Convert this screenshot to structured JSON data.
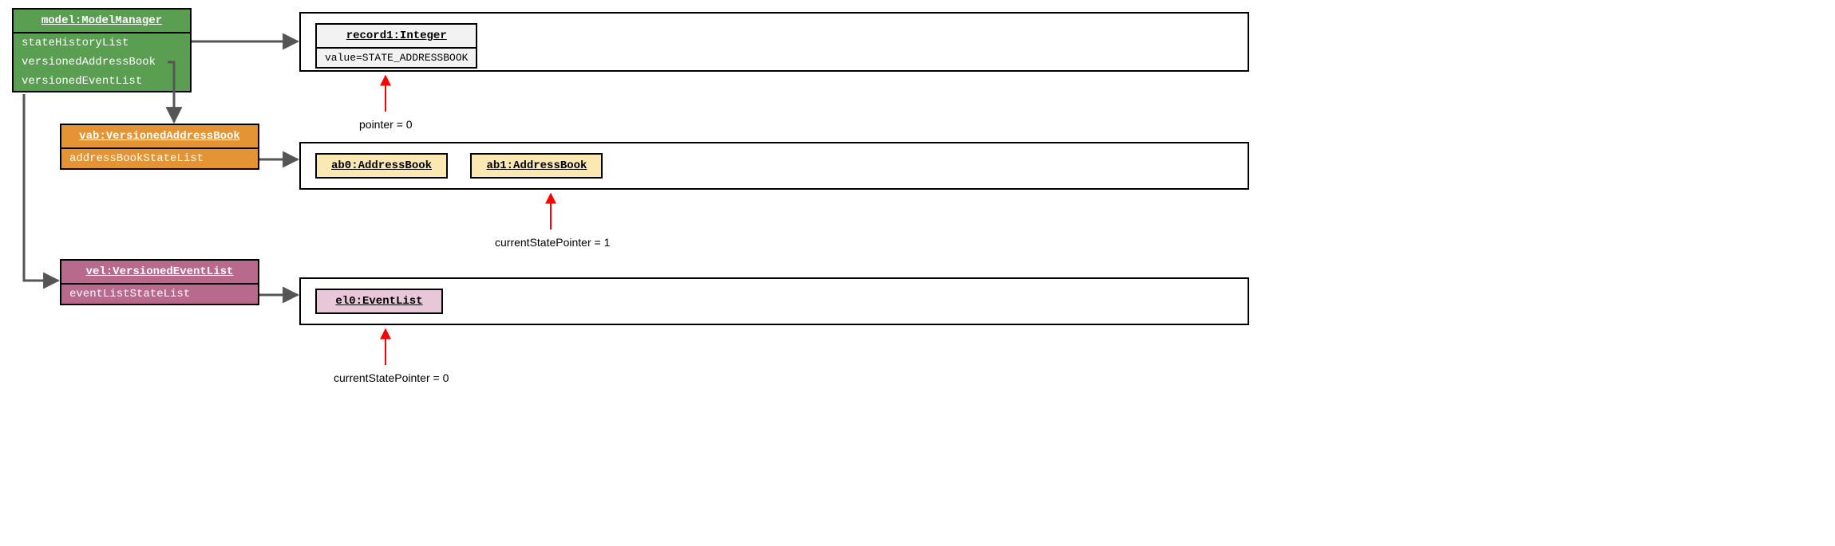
{
  "model": {
    "title": "model:ModelManager",
    "attrs": [
      "stateHistoryList",
      "versionedAddressBook",
      "versionedEventList"
    ]
  },
  "vab": {
    "title": "vab:VersionedAddressBook",
    "attrs": [
      "addressBookStateList"
    ]
  },
  "vel": {
    "title": "vel:VersionedEventList",
    "attrs": [
      "eventListStateList"
    ]
  },
  "stateHistory": {
    "record": {
      "title": "record1:Integer",
      "attr": "value=STATE_ADDRESSBOOK"
    },
    "pointerLabel": "pointer = 0"
  },
  "abList": {
    "items": [
      {
        "title": "ab0:AddressBook"
      },
      {
        "title": "ab1:AddressBook"
      }
    ],
    "pointerLabel": "currentStatePointer = 1"
  },
  "elList": {
    "items": [
      {
        "title": "el0:EventList"
      }
    ],
    "pointerLabel": "currentStatePointer = 0"
  }
}
